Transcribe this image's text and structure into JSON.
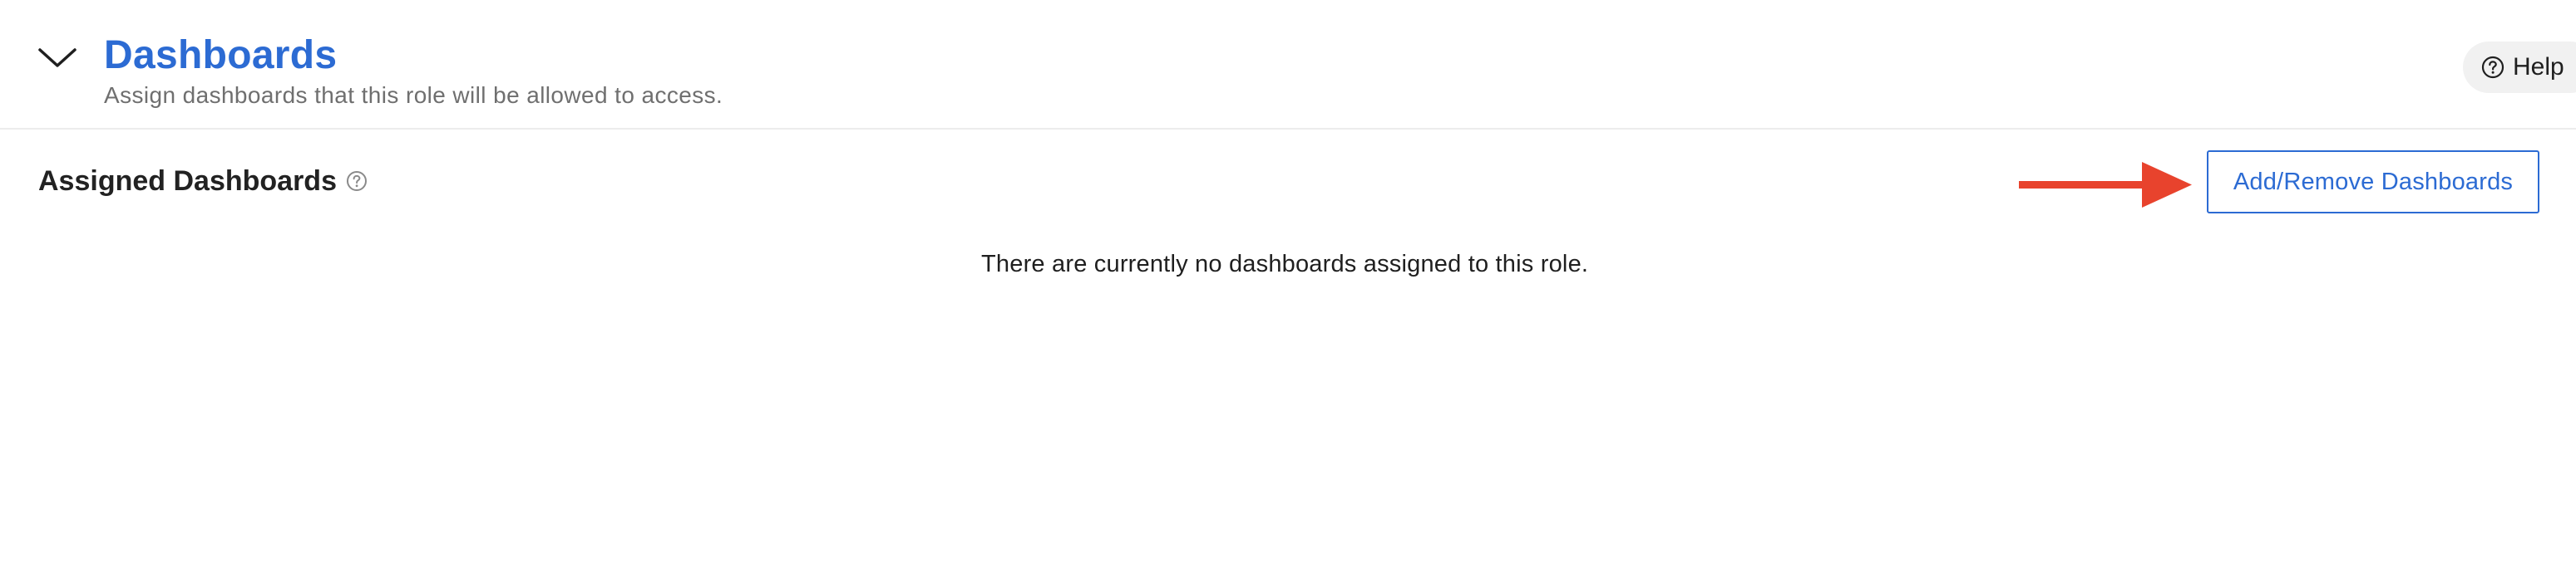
{
  "section": {
    "title": "Dashboards",
    "subtitle": "Assign dashboards that this role will be allowed to access.",
    "collapse_icon": "chevron-down-icon"
  },
  "help": {
    "label": "Help",
    "icon": "question-circle-icon"
  },
  "assigned": {
    "title": "Assigned Dashboards",
    "info_icon": "question-circle-icon",
    "add_remove_label": "Add/Remove Dashboards",
    "empty_message": "There are currently no dashboards assigned to this role."
  },
  "annotation": {
    "arrow_color": "#e8432d"
  },
  "colors": {
    "accent": "#2c6bd3",
    "subtitle": "#6f6f6f",
    "divider": "#ececec"
  }
}
